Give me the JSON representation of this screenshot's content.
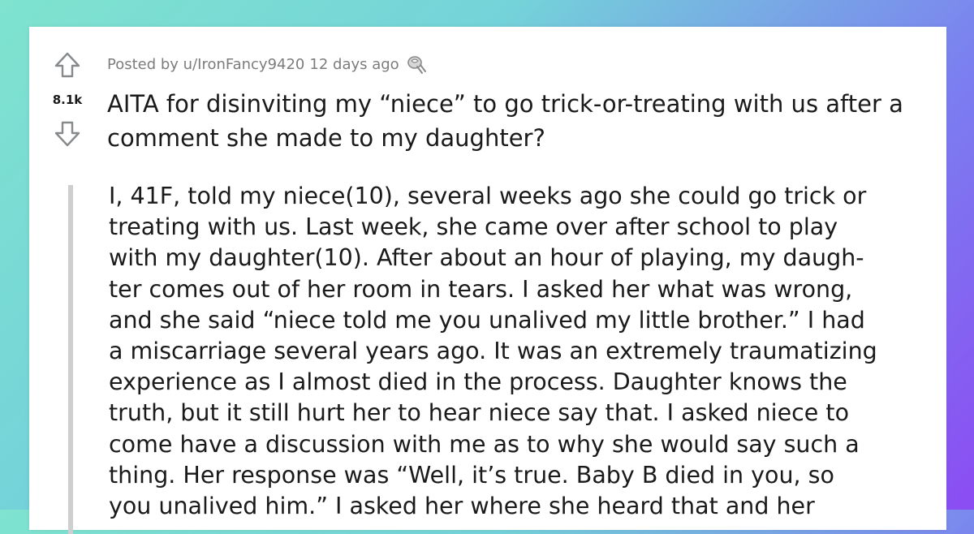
{
  "post": {
    "score": "8.1k",
    "meta": {
      "posted_by": "Posted by u/IronFancy9420",
      "age": "12 days ago"
    },
    "title": "AITA for disinviting my “niece” to go trick-or-treating with us after a comment she made to my daughter?",
    "body_lines": [
      "I, 41F, told my niece(10), several weeks ago she could go trick or",
      "treating with us. Last week, she came over after school to play",
      "with my daughter(10). After about an hour of playing, my daugh-",
      "ter comes out of her room in tears. I asked her what was wrong,",
      "and she said “niece told me you unalived my little brother.” I had",
      "a miscarriage several years ago. It was an extremely traumatizing",
      "experience as I almost died in the process. Daughter knows the",
      "truth, but it still hurt her to hear niece say that. I asked niece to",
      "come have a discussion with me as to why she would say such a",
      "thing. Her response was “Well, it’s true. Baby B died in you, so",
      "you unalived him.” I asked her where she heard that and her"
    ]
  },
  "icons": {
    "upvote": "upvote-arrow-icon",
    "downvote": "downvote-arrow-icon",
    "award": "award-icon"
  }
}
